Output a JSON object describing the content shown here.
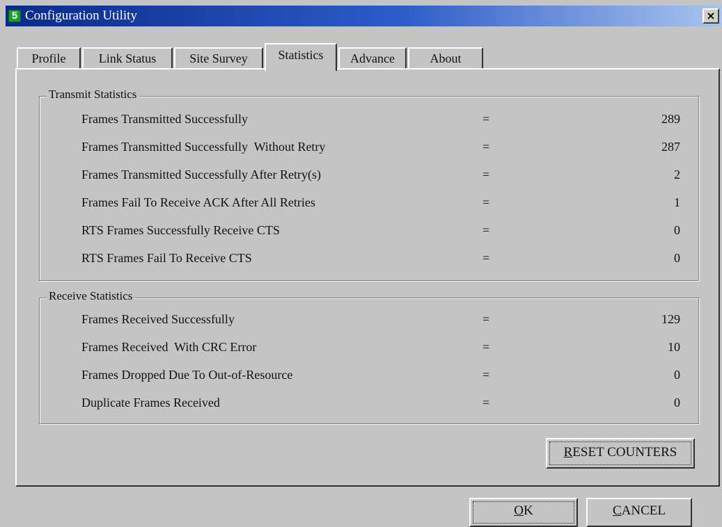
{
  "window": {
    "title": "Configuration Utility",
    "close_glyph": "×"
  },
  "tabs": [
    {
      "label": "Profile"
    },
    {
      "label": "Link Status"
    },
    {
      "label": "Site Survey"
    },
    {
      "label": "Statistics"
    },
    {
      "label": "Advance"
    },
    {
      "label": "About"
    }
  ],
  "active_tab": "Statistics",
  "transmit": {
    "title": "Transmit Statistics",
    "rows": [
      {
        "label": "Frames Transmitted Successfully",
        "eq": "=",
        "value": "289"
      },
      {
        "label": "Frames Transmitted Successfully  Without Retry",
        "eq": "=",
        "value": "287"
      },
      {
        "label": "Frames Transmitted Successfully After Retry(s)",
        "eq": "=",
        "value": "2"
      },
      {
        "label": "Frames Fail To Receive ACK After All Retries",
        "eq": "=",
        "value": "1"
      },
      {
        "label": "RTS Frames Successfully Receive CTS",
        "eq": "=",
        "value": "0"
      },
      {
        "label": "RTS Frames Fail To Receive CTS",
        "eq": "=",
        "value": "0"
      }
    ]
  },
  "receive": {
    "title": "Receive Statistics",
    "rows": [
      {
        "label": "Frames Received Successfully",
        "eq": "=",
        "value": "129"
      },
      {
        "label": "Frames Received  With CRC Error",
        "eq": "=",
        "value": "10"
      },
      {
        "label": "Frames Dropped Due To Out-of-Resource",
        "eq": "=",
        "value": "0"
      },
      {
        "label": "Duplicate Frames Received",
        "eq": "=",
        "value": "0"
      }
    ]
  },
  "buttons": {
    "reset_first": "R",
    "reset_rest": "ESET COUNTERS",
    "ok_first": "O",
    "ok_rest": "K",
    "cancel_first": "C",
    "cancel_rest": "ANCEL"
  }
}
